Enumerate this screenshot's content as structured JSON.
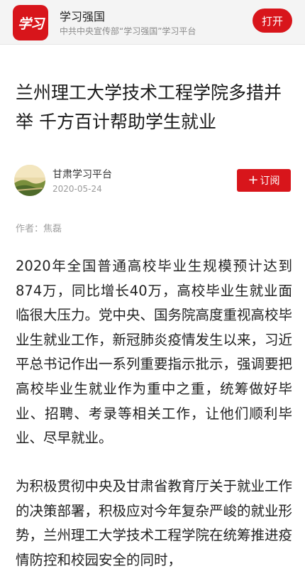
{
  "topbar": {
    "logo_text": "学习",
    "app_name": "学习强国",
    "app_subtitle": "中共中央宣传部“学习强国”学习平台",
    "open_label": "打开"
  },
  "article": {
    "title": "兰州理工大学技术工程学院多措并举 千方百计帮助学生就业",
    "source_name": "甘肃学习平台",
    "date": "2020-05-24",
    "subscribe_label": "订阅",
    "author_line": "作者：焦磊",
    "paragraphs": [
      "2020年全国普通高校毕业生规模预计达到874万，同比增长40万，高校毕业生就业面临很大压力。党中央、国务院高度重视高校毕业生就业工作，新冠肺炎疫情发生以来，习近平总书记作出一系列重要指示批示，强调要把高校毕业生就业作为重中之重，统筹做好毕业、招聘、考录等相关工作，让他们顺利毕业、尽早就业。",
      "为积极贯彻中央及甘肃省教育厅关于就业工作的决策部署，积极应对今年复杂严峻的就业形势，兰州理工大学技术工程学院在统筹推进疫情防控和校园安全的同时，"
    ]
  },
  "colors": {
    "accent": "#d8151b",
    "meta_gray": "#9a9a9a"
  }
}
